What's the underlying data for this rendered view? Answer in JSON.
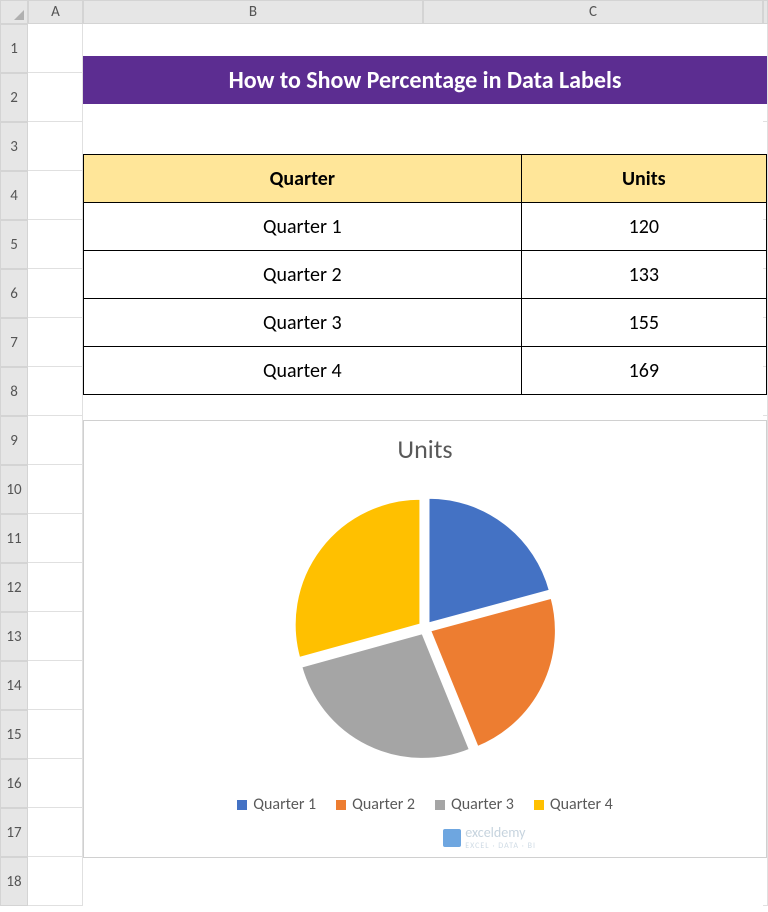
{
  "columns": [
    "A",
    "B",
    "C"
  ],
  "rows": [
    "1",
    "2",
    "3",
    "4",
    "5",
    "6",
    "7",
    "8",
    "9",
    "10",
    "11",
    "12",
    "13",
    "14",
    "15",
    "16",
    "17",
    "18"
  ],
  "title": "How to Show Percentage in Data Labels",
  "table": {
    "headers": {
      "col1": "Quarter",
      "col2": "Units"
    },
    "rows": [
      {
        "quarter": "Quarter 1",
        "units": "120"
      },
      {
        "quarter": "Quarter 2",
        "units": "133"
      },
      {
        "quarter": "Quarter 3",
        "units": "155"
      },
      {
        "quarter": "Quarter 4",
        "units": "169"
      }
    ]
  },
  "chart_data": {
    "type": "pie",
    "title": "Units",
    "categories": [
      "Quarter 1",
      "Quarter 2",
      "Quarter 3",
      "Quarter 4"
    ],
    "values": [
      120,
      133,
      155,
      169
    ],
    "colors": [
      "#4472c4",
      "#ed7d31",
      "#a5a5a5",
      "#ffc000"
    ],
    "legend_position": "bottom"
  },
  "watermark": {
    "brand": "exceldemy",
    "tagline": "EXCEL · DATA · BI"
  }
}
